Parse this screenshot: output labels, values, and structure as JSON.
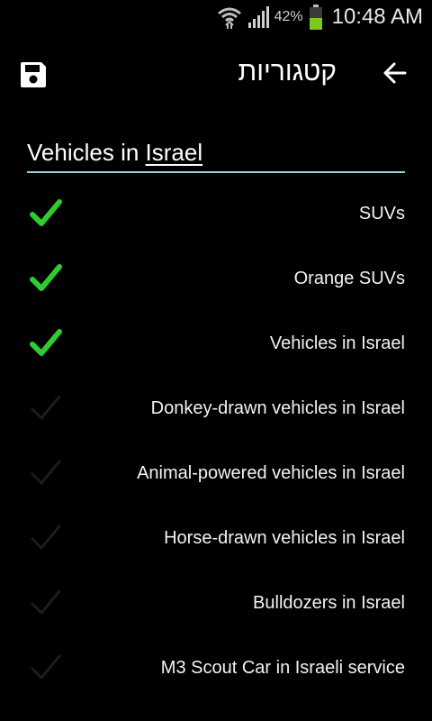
{
  "status_bar": {
    "battery_percent": "42%",
    "time": "10:48 AM",
    "icons": [
      "wifi-icon",
      "signal-icon",
      "battery-icon"
    ]
  },
  "app_bar": {
    "title": "קטגוריות",
    "icons": [
      "save-icon",
      "back-arrow-icon"
    ]
  },
  "search": {
    "prefix": "Vehicles in ",
    "underlined": "Israel",
    "underline_color": "#8fd6d0"
  },
  "colors": {
    "check_active": "#2ecc2e",
    "check_inactive": "#1c1c1c"
  },
  "categories": [
    {
      "label": "SUVs",
      "checked": true
    },
    {
      "label": "Orange SUVs",
      "checked": true
    },
    {
      "label": "Vehicles in Israel",
      "checked": true
    },
    {
      "label": "Donkey-drawn vehicles in Israel",
      "checked": false
    },
    {
      "label": "Animal-powered vehicles in Israel",
      "checked": false
    },
    {
      "label": "Horse-drawn vehicles in Israel",
      "checked": false
    },
    {
      "label": "Bulldozers in Israel",
      "checked": false
    },
    {
      "label": "M3 Scout Car in Israeli service",
      "checked": false
    }
  ]
}
